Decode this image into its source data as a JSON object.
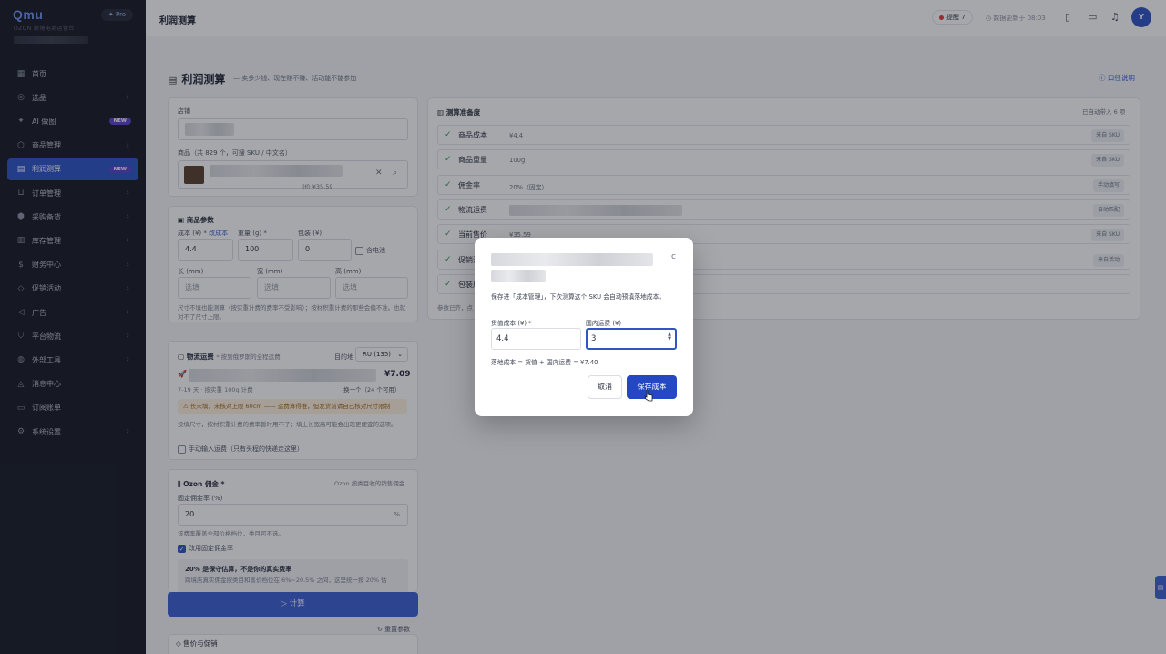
{
  "brand": {
    "logo": "Qmu",
    "pro": "✦ Pro",
    "subtitle": "OZON 跨境电商运营台"
  },
  "nav": [
    {
      "label": "首页",
      "icon": "grid-icon",
      "chev": false
    },
    {
      "label": "选品",
      "icon": "target-icon",
      "chev": true
    },
    {
      "label": "AI 做图",
      "icon": "sparkle-icon",
      "chev": false,
      "badge": "NEW"
    },
    {
      "label": "商品管理",
      "icon": "box-icon",
      "chev": true
    },
    {
      "label": "利润测算",
      "icon": "calculator-icon",
      "chev": false,
      "badge": "NEW",
      "active": true
    },
    {
      "label": "订单管理",
      "icon": "cart-icon",
      "chev": true
    },
    {
      "label": "采购备货",
      "icon": "package-icon",
      "chev": true
    },
    {
      "label": "库存管理",
      "icon": "warehouse-icon",
      "chev": true
    },
    {
      "label": "财务中心",
      "icon": "dollar-icon",
      "chev": true
    },
    {
      "label": "促销活动",
      "icon": "tag-icon",
      "chev": true
    },
    {
      "label": "广告",
      "icon": "megaphone-icon",
      "chev": true
    },
    {
      "label": "平台物流",
      "icon": "shield-icon",
      "chev": true
    },
    {
      "label": "外部工具",
      "icon": "globe-icon",
      "chev": true
    },
    {
      "label": "消息中心",
      "icon": "bell-icon",
      "chev": false
    },
    {
      "label": "订阅账单",
      "icon": "card-icon",
      "chev": false
    },
    {
      "label": "系统设置",
      "icon": "gear-icon",
      "chev": true
    }
  ],
  "header": {
    "title": "利润测算",
    "remind": "提醒",
    "remind_count": "7",
    "updated": "数据更新于 08:03"
  },
  "avatar": "Y",
  "page": {
    "title": "利润测算",
    "desc": "— 卖多少钱、现在赚不赚、活动能不能参加",
    "help": "口径说明"
  },
  "store": {
    "label": "店铺"
  },
  "product": {
    "label": "商品（共 829 个，可搜 SKU / 中文名）",
    "price": "|价 ¥35.59"
  },
  "params": {
    "title": "商品参数",
    "cost_label": "成本 (¥) *",
    "cost_link": "改成本",
    "cost": "4.4",
    "weight_label": "重量 (g) *",
    "weight": "100",
    "pack_label": "包装 (¥)",
    "pack": "0",
    "battery": "含电池",
    "len_label": "长 (mm)",
    "wid_label": "宽 (mm)",
    "hei_label": "高 (mm)",
    "placeholder": "选填",
    "note": "尺寸不填也能测算（按实重计费的费率不受影响）；按材积重计费的那些会偏不准。也就对不了尺寸上限。"
  },
  "logistics": {
    "title": "物流运费",
    "title_note": "* 按到俄罗斯的全程运费",
    "dest_label": "目的地",
    "dest": "RU (135)",
    "price": "¥7.09",
    "days": "7-19 天 · 按实重 100g 计费",
    "switch": "换一个（24 个可用）",
    "warn": "⚠ 长未填，未核对上限 60cm —— 运费算得准，但发货前请自己核对尺寸限制",
    "note": "没填尺寸，按材积重计费的费率暂时用不了；填上长宽高可能会出现更便宜的选项。",
    "manual": "手动输入运费（只有头程的快递走这里）"
  },
  "commission": {
    "title": "Ozon 佣金 *",
    "right": "Ozon 按类目收的销售佣金",
    "rate_label": "固定佣金率 (%)",
    "rate": "20",
    "unit": "%",
    "note": "该费率覆盖全部价格档位，类目可不选。",
    "fixed": "改用固定佣金率",
    "tip_title": "20% 是保守估算，不是你的真实费率",
    "tip_body": "跨境店真实佣金按类目和售价档位在 6%~20.5% 之间，这里统一按 20% 估"
  },
  "calc": "▷ 计算",
  "reset": "↻ 重置参数",
  "sell": "售价与促销",
  "ready": {
    "title": "测算准备度",
    "auto": "已自动带入 6 项",
    "note": "参数已齐，点"
  },
  "rows": [
    {
      "label": "商品成本",
      "value": "¥4.4",
      "tag": "来自 SKU"
    },
    {
      "label": "商品重量",
      "value": "100g",
      "tag": "来自 SKU"
    },
    {
      "label": "佣金率",
      "value": "20%（固定）",
      "tag": "手动填写"
    },
    {
      "label": "物流运费",
      "value": "",
      "tag": "自动匹配"
    },
    {
      "label": "当前售价",
      "value": "¥35.59",
      "tag": "来自 SKU"
    },
    {
      "label": "促销活",
      "value": "",
      "tag": "来自活动"
    },
    {
      "label": "包装成",
      "value": "",
      "tag": ""
    }
  ],
  "modal": {
    "close": "c",
    "desc": "保存进「成本管理」，下次测算这个 SKU 会自动预填落地成本。",
    "cost_label": "货值成本 (¥) *",
    "cost": "4.4",
    "ship_label": "国内运费 (¥)",
    "ship": "3",
    "formula": "落地成本 = 货值 + 国内运费 = ¥7.40",
    "cancel": "取消",
    "save": "保存成本"
  }
}
